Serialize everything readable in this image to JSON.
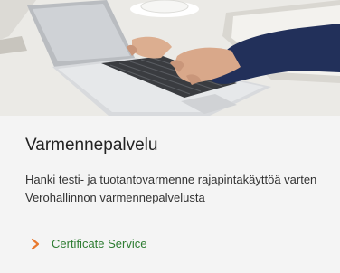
{
  "card": {
    "title": "Varmennepalvelu",
    "description": "Hanki testi- ja tuotantovarmenne rajapintakäyttöä varten Verohallinnon varmennepalvelusta",
    "link": {
      "label": "Certificate Service",
      "icon": "chevron-right-icon",
      "icon_color": "#e8792f"
    },
    "image": {
      "subject": "hands-typing-on-laptop"
    }
  },
  "colors": {
    "background": "#f4f4f4",
    "title": "#222222",
    "text": "#333333",
    "link": "#2e7d32",
    "accent": "#e8792f"
  }
}
